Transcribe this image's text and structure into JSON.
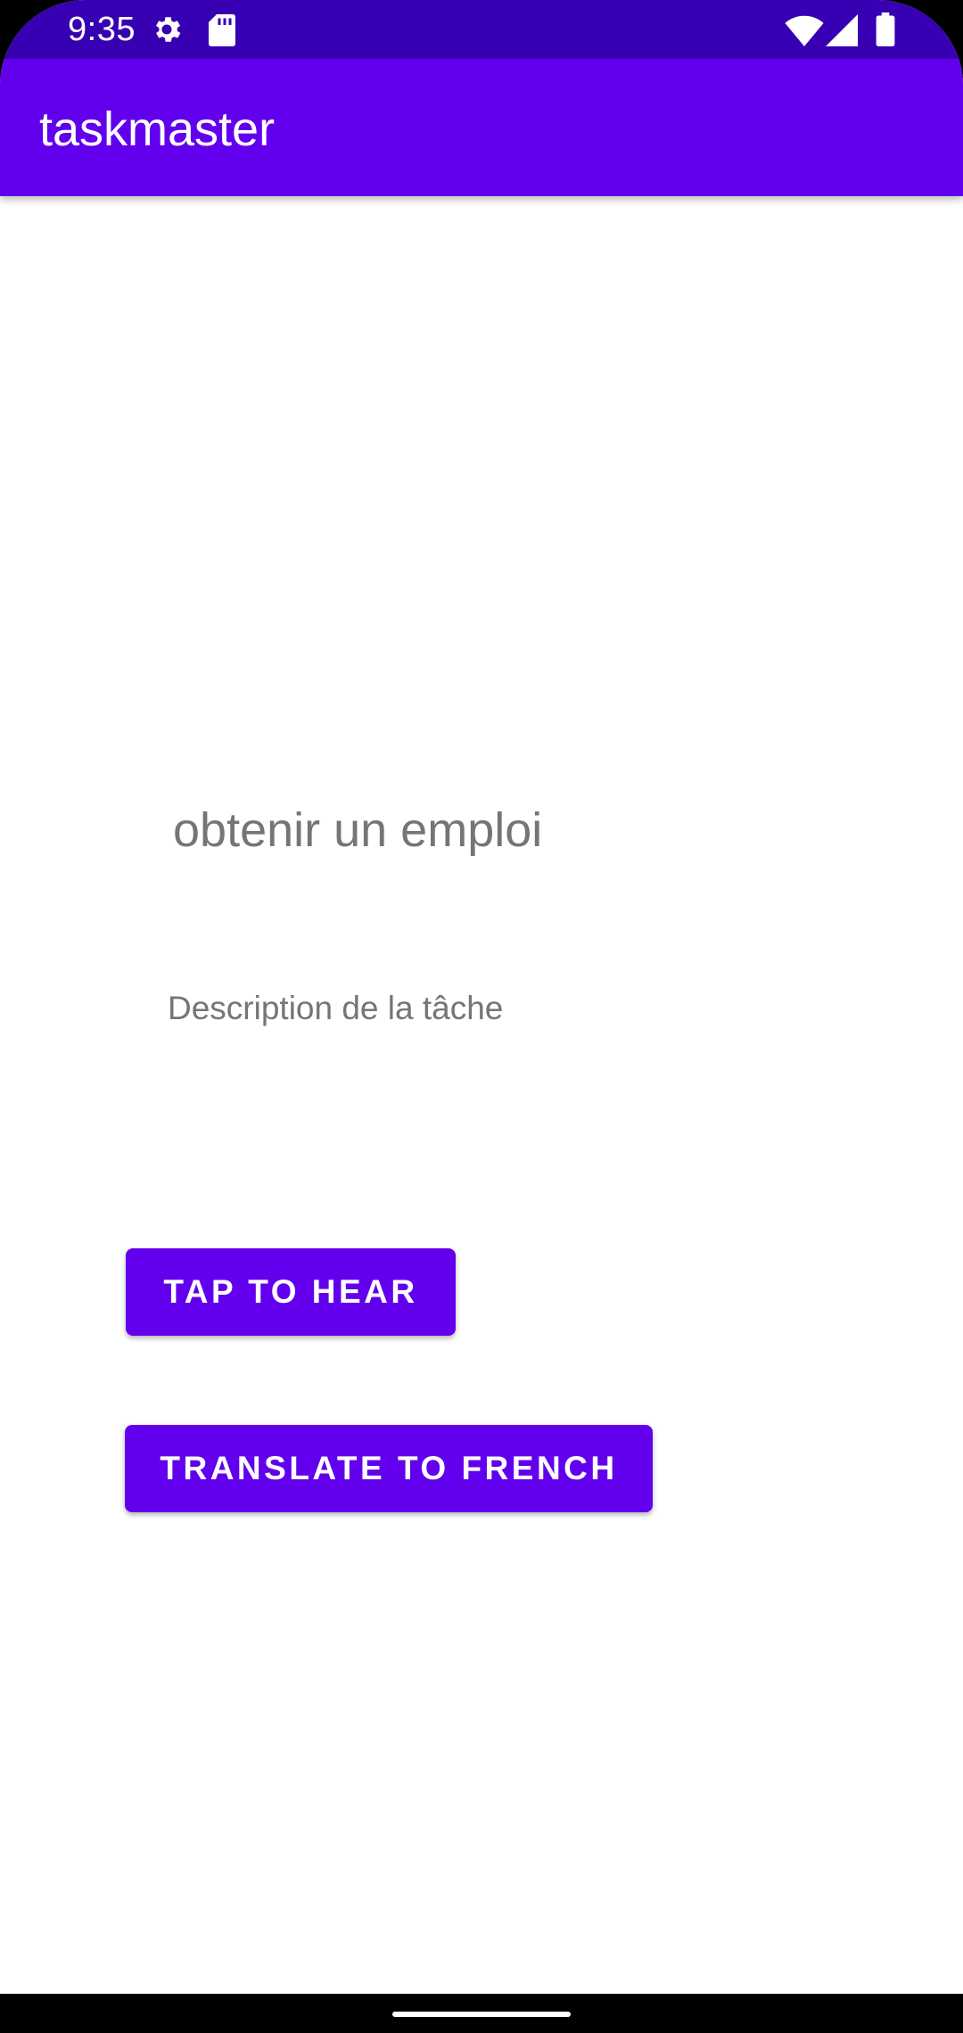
{
  "status_bar": {
    "time": "9:35",
    "icons": [
      "gear-icon",
      "sd-card-icon",
      "wifi-icon",
      "signal-icon",
      "battery-icon"
    ]
  },
  "app_bar": {
    "title": "taskmaster"
  },
  "task": {
    "title": "obtenir un emploi",
    "description": "Description de la tâche"
  },
  "buttons": {
    "tap_to_hear": "TAP TO HEAR",
    "translate": "TRANSLATE TO FRENCH"
  },
  "colors": {
    "status_bar": "#3700B3",
    "primary": "#6200EE",
    "text_secondary": "#757575"
  }
}
